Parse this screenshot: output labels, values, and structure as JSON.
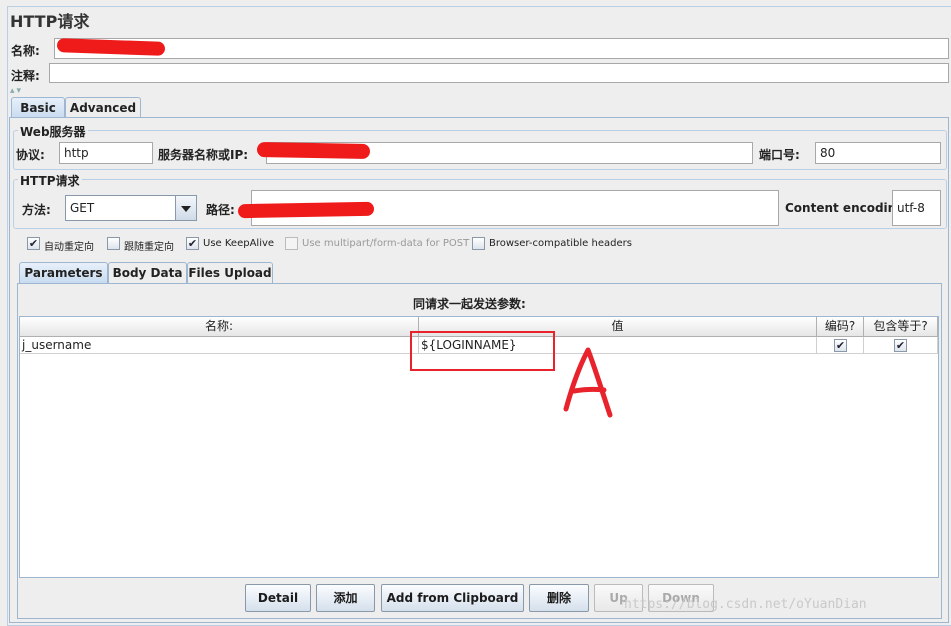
{
  "window": {
    "title": "HTTP请求"
  },
  "name_row": {
    "label": "名称:",
    "value": ""
  },
  "comment_row": {
    "label": "注释:",
    "value": ""
  },
  "top_tabs": [
    {
      "label": "Basic",
      "active": true
    },
    {
      "label": "Advanced",
      "active": false
    }
  ],
  "web_server": {
    "group_title": "Web服务器",
    "protocol_label": "协议:",
    "protocol_value": "http",
    "server_label": "服务器名称或IP:",
    "server_value": "",
    "port_label": "端口号:",
    "port_value": "80"
  },
  "http_request": {
    "group_title": "HTTP请求",
    "method_label": "方法:",
    "method_value": "GET",
    "path_label": "路径:",
    "path_value": "",
    "encoding_label": "Content encoding:",
    "encoding_value": "utf-8"
  },
  "options": [
    {
      "label": "自动重定向",
      "checked": true,
      "enabled": true
    },
    {
      "label": "跟随重定向",
      "checked": false,
      "enabled": true
    },
    {
      "label": "Use KeepAlive",
      "checked": true,
      "enabled": true
    },
    {
      "label": "Use multipart/form-data for POST",
      "checked": false,
      "enabled": false
    },
    {
      "label": "Browser-compatible headers",
      "checked": false,
      "enabled": true
    }
  ],
  "param_tabs": [
    {
      "label": "Parameters",
      "active": true
    },
    {
      "label": "Body Data",
      "active": false
    },
    {
      "label": "Files Upload",
      "active": false
    }
  ],
  "params_table": {
    "caption": "同请求一起发送参数:",
    "columns": [
      "名称:",
      "值",
      "编码?",
      "包含等于?"
    ],
    "rows": [
      {
        "name": "j_username",
        "value": "${LOGINNAME}",
        "encode": true,
        "include_equals": true
      }
    ]
  },
  "buttons": [
    {
      "label": "Detail",
      "enabled": true
    },
    {
      "label": "添加",
      "enabled": true
    },
    {
      "label": "Add from Clipboard",
      "enabled": true
    },
    {
      "label": "删除",
      "enabled": true
    },
    {
      "label": "Up",
      "enabled": false
    },
    {
      "label": "Down",
      "enabled": false
    }
  ],
  "annotation": {
    "letter": "A",
    "color": "#e8232b"
  },
  "watermark": "https://blog.csdn.net/oYuanDian",
  "colors": {
    "redaction": "#ef1b1b",
    "tab_border": "#9eb6cf",
    "background": "#eeeeee"
  }
}
